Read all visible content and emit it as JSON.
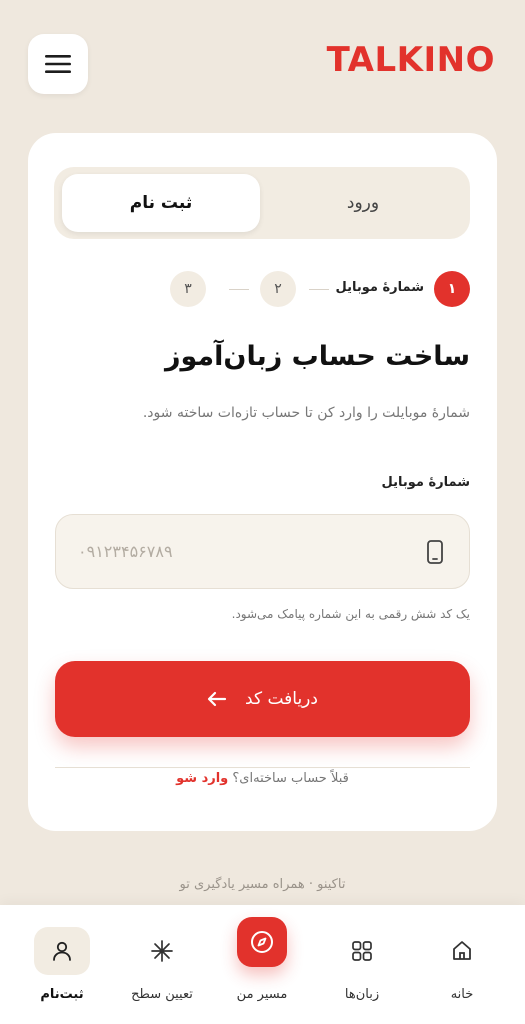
{
  "brand": {
    "logo_text": "TALKINO",
    "accent_color": "#e2322c"
  },
  "header": {
    "menu_icon": "hamburger-menu-icon"
  },
  "auth": {
    "tabs": [
      {
        "label": "ورود",
        "active": false
      },
      {
        "label": "ثبت نام",
        "active": true
      }
    ],
    "steps": [
      {
        "number": "۱",
        "label": "شمارهٔ موبایل",
        "active": true
      },
      {
        "number": "۲",
        "active": false
      },
      {
        "number": "۳",
        "active": false
      }
    ],
    "title": "ساخت حساب زبان‌آموز",
    "subtitle": "شمارهٔ موبایلت را وارد کن تا حساب تازه‌ات ساخته شود.",
    "phone_field": {
      "label": "شمارهٔ موبایل",
      "placeholder": "۰۹۱۲۳۴۵۶۷۸۹",
      "icon": "phone-icon"
    },
    "hint": "یک کد شش رقمی به این شماره پیامک می‌شود.",
    "submit_label": "دریافت کد",
    "already_text": "قبلاً حساب ساخته‌ای؟",
    "login_link": "وارد شو"
  },
  "footer_note": "تاکینو · همراه مسیر یادگیری تو",
  "bottom_nav": [
    {
      "label": "خانه",
      "icon": "home-icon"
    },
    {
      "label": "زبان‌ها",
      "icon": "grid-icon"
    },
    {
      "label": "مسیر من",
      "icon": "compass-icon"
    },
    {
      "label": "تعیین سطح",
      "icon": "asterisk-icon"
    },
    {
      "label": "ثبت‌نام",
      "icon": "user-icon",
      "active": true
    }
  ]
}
